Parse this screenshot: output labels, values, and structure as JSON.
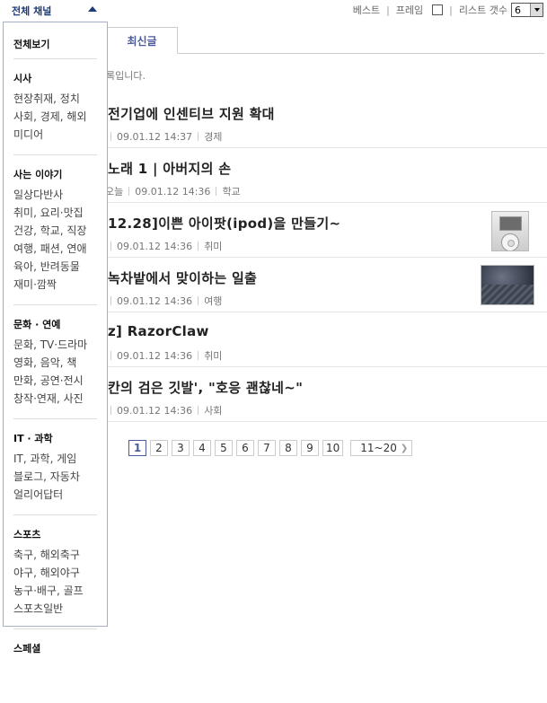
{
  "topbar": {
    "best_label": "베스트",
    "frame_label": "프레임",
    "list_count_label": "리스트 갯수",
    "list_count_value": "6"
  },
  "tabs": [
    {
      "label": "최신글"
    }
  ],
  "notice_text": "록입니다.",
  "articles": [
    {
      "title": "전기업에 인센티브 지원 확대",
      "meta_prefix": "",
      "date": "09.01.12 14:37",
      "category": "경제",
      "thumbnail": null
    },
    {
      "title": "노래 1 | 아버지의 손",
      "meta_prefix": "오늘",
      "date": "09.01.12 14:36",
      "category": "학교",
      "thumbnail": null
    },
    {
      "title": "12.28]이쁜 아이팟(ipod)을 만들기~",
      "meta_prefix": "",
      "date": "09.01.12 14:36",
      "category": "취미",
      "thumbnail": "ipod"
    },
    {
      "title": "녹차밭에서 맞이하는 일출",
      "meta_prefix": "",
      "date": "09.01.12 14:36",
      "category": "여행",
      "thumbnail": "sunrise"
    },
    {
      "title": "z] RazorClaw",
      "meta_prefix": "",
      "date": "09.01.12 14:36",
      "category": "취미",
      "thumbnail": null
    },
    {
      "title": "칸의 검은 깃발', \"호응 괜찮네~\"",
      "meta_prefix": "",
      "date": "09.01.12 14:36",
      "category": "사회",
      "thumbnail": null
    }
  ],
  "pagination": {
    "pages": [
      "1",
      "2",
      "3",
      "4",
      "5",
      "6",
      "7",
      "8",
      "9",
      "10"
    ],
    "active": "1",
    "next_range": "11~20"
  },
  "channel": {
    "header": "전체 채널",
    "all_label": "전체보기",
    "groups": [
      {
        "title": "시사",
        "items": [
          "현장취재, 정치",
          "사회, 경제, 해외",
          "미디어"
        ]
      },
      {
        "title": "사는 이야기",
        "items": [
          "일상다반사",
          "취미, 요리·맛집",
          "건강, 학교, 직장",
          "여행, 패션, 연애",
          "육아, 반려동물",
          "재미·깜짝"
        ]
      },
      {
        "title": "문화 · 연예",
        "items": [
          "문화, TV·드라마",
          "영화, 음악, 책",
          "만화, 공연·전시",
          "창작·연재, 사진"
        ]
      },
      {
        "title": "IT · 과학",
        "items": [
          "IT, 과학, 게임",
          "블로그, 자동차",
          "얼리어답터"
        ]
      },
      {
        "title": "스포츠",
        "items": [
          "축구, 해외축구",
          "야구, 해외야구",
          "농구·배구, 골프",
          "스포츠일반"
        ]
      },
      {
        "title": "스페셜",
        "items": []
      }
    ]
  }
}
